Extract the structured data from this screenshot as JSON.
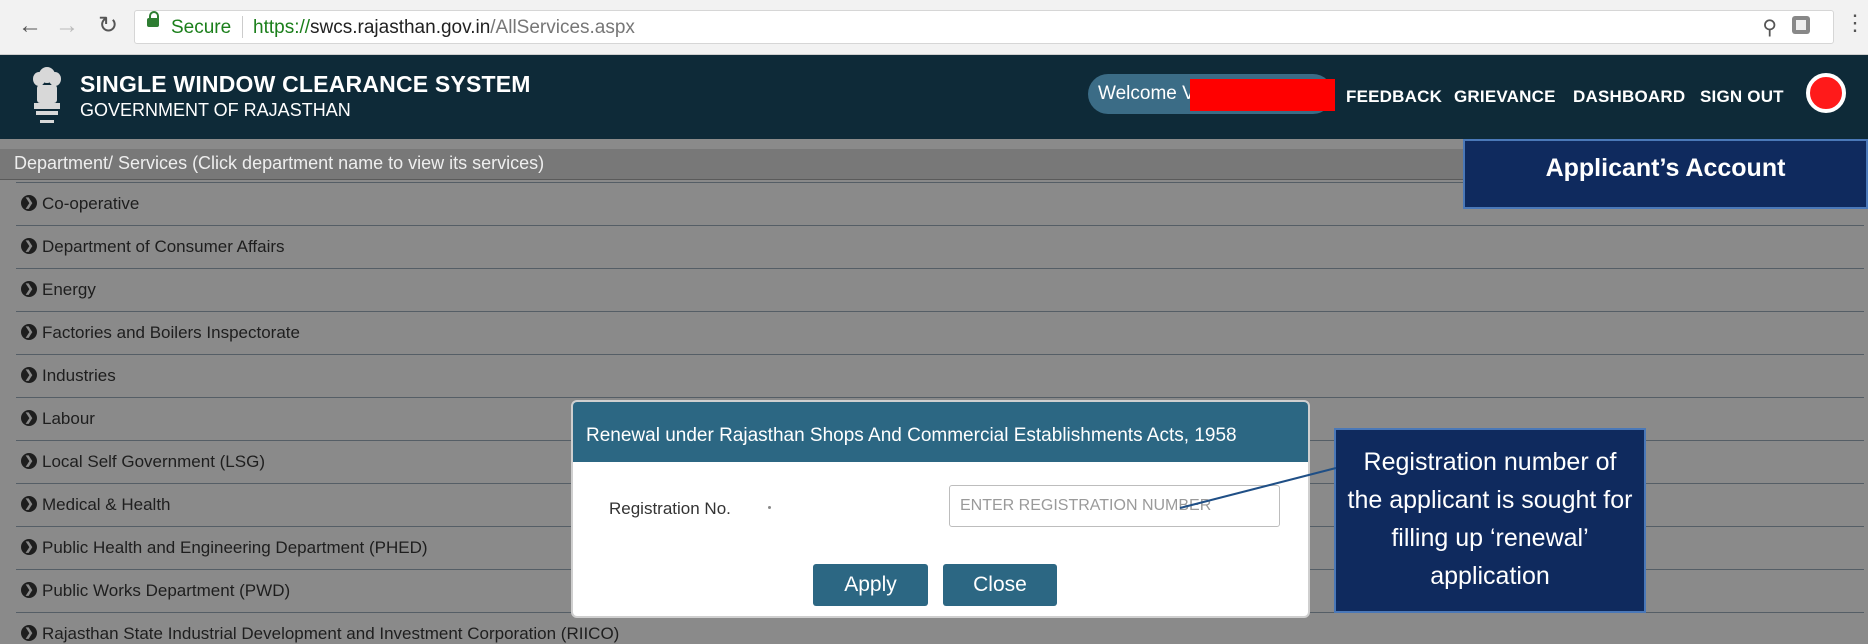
{
  "browser": {
    "secure_label": "Secure",
    "url_protocol": "https://",
    "url_host": "swcs.rajasthan.gov.in",
    "url_path": "/AllServices.aspx"
  },
  "header": {
    "title": "SINGLE WINDOW CLEARANCE SYSTEM",
    "subtitle": "GOVERNMENT OF RAJASTHAN",
    "welcome": "Welcome V",
    "nav": [
      "FEEDBACK",
      "GRIEVANCE",
      "DASHBOARD",
      "SIGN OUT"
    ]
  },
  "departments": {
    "header": "Department/ Services (Click department name to view its services)",
    "items": [
      "Co-operative",
      "Department of Consumer Affairs",
      "Energy",
      "Factories and Boilers Inspectorate",
      "Industries",
      "Labour",
      "Local Self Government (LSG)",
      "Medical & Health",
      "Public Health and Engineering Department (PHED)",
      "Public Works Department (PWD)",
      "Rajasthan State Industrial Development and Investment Corporation (RIICO)"
    ]
  },
  "annotations": {
    "account": "Applicant’s Account",
    "registration": "Registration number of the applicant is sought for filling up ‘renewal’ application"
  },
  "modal": {
    "title": "Renewal under Rajasthan Shops And Commercial Establishments Acts, 1958",
    "reg_label": "Registration No.",
    "reg_placeholder": "ENTER REGISTRATION NUMBER",
    "apply_label": "Apply",
    "close_label": "Close"
  },
  "colors": {
    "header_bg": "#0e2a38",
    "modal_accent": "#2c6783",
    "callout_bg": "#0f2a5e",
    "redaction": "#ff0000"
  }
}
